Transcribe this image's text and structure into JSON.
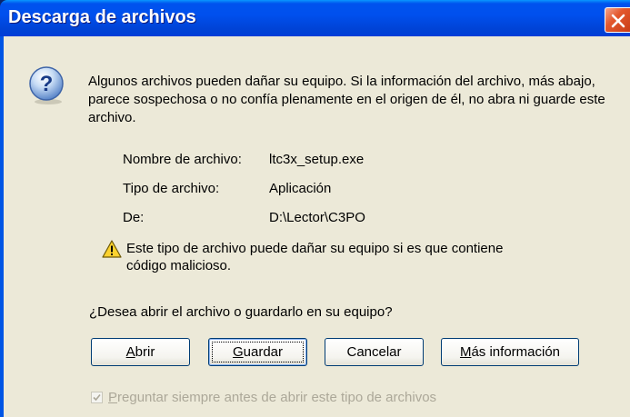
{
  "window": {
    "title": "Descarga de archivos"
  },
  "dialog": {
    "message": "Algunos archivos pueden dañar su equipo. Si la información del archivo, más abajo, parece sospechosa o no confía plenamente en el origen de él, no abra ni guarde este archivo.",
    "file_info": {
      "name_label": "Nombre de archivo:",
      "name_value": "ltc3x_setup.exe",
      "type_label": "Tipo de archivo:",
      "type_value": "Aplicación",
      "from_label": "De:",
      "from_value": "D:\\Lector\\C3PO"
    },
    "warning": "Este tipo de archivo puede dañar su equipo si es que contiene código malicioso.",
    "question": "¿Desea abrir el archivo o guardarlo en su equipo?",
    "buttons": {
      "open": {
        "mnemonic": "A",
        "rest": "brir"
      },
      "save": {
        "mnemonic": "G",
        "rest": "uardar"
      },
      "cancel": {
        "label": "Cancelar"
      },
      "more_info": {
        "mnemonic": "M",
        "rest": "ás información"
      }
    },
    "checkbox": {
      "mnemonic": "P",
      "rest": "reguntar siempre antes de abrir este tipo de archivos",
      "checked": true
    }
  },
  "icons": {
    "question": "question-icon",
    "warning": "warning-icon",
    "close": "close-icon"
  },
  "colors": {
    "titlebar": "#0053EE",
    "close_button": "#E3582D",
    "dialog_background": "#ECE9D8",
    "button_border": "#003C74",
    "disabled_text": "#ACA899"
  }
}
